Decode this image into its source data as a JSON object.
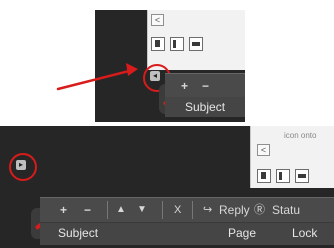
{
  "ui": {
    "caption": "icon onto",
    "top_panel": {
      "tab_toggle": "<",
      "collapse_arrow": "◂",
      "toolbar": {
        "plus": "+",
        "minus": "−"
      },
      "header": {
        "subject": "Subject"
      }
    },
    "bottom_panel": {
      "tab_toggle": "<",
      "collapse_arrow": "▸",
      "toolbar": {
        "plus": "+",
        "minus": "−",
        "up": "▲",
        "down": "▼",
        "close": "X",
        "reply_icon": "↪",
        "reply": "Reply",
        "status_icon": "Ⓡ",
        "status": "Statu"
      },
      "header": {
        "subject": "Subject",
        "page": "Page",
        "lock": "Lock"
      }
    }
  },
  "colors": {
    "highlight": "#d81b1b",
    "dark_panel": "#262626",
    "toolbar": "#4a4a4a"
  },
  "icons": {
    "top_mini_icons": [
      "document-icon",
      "split-icon",
      "save-icon"
    ],
    "bottom_mini_icons": [
      "document-icon",
      "split-icon",
      "save-icon"
    ],
    "pencil": "pencil-icon",
    "arrow": "red-arrow-icon"
  }
}
